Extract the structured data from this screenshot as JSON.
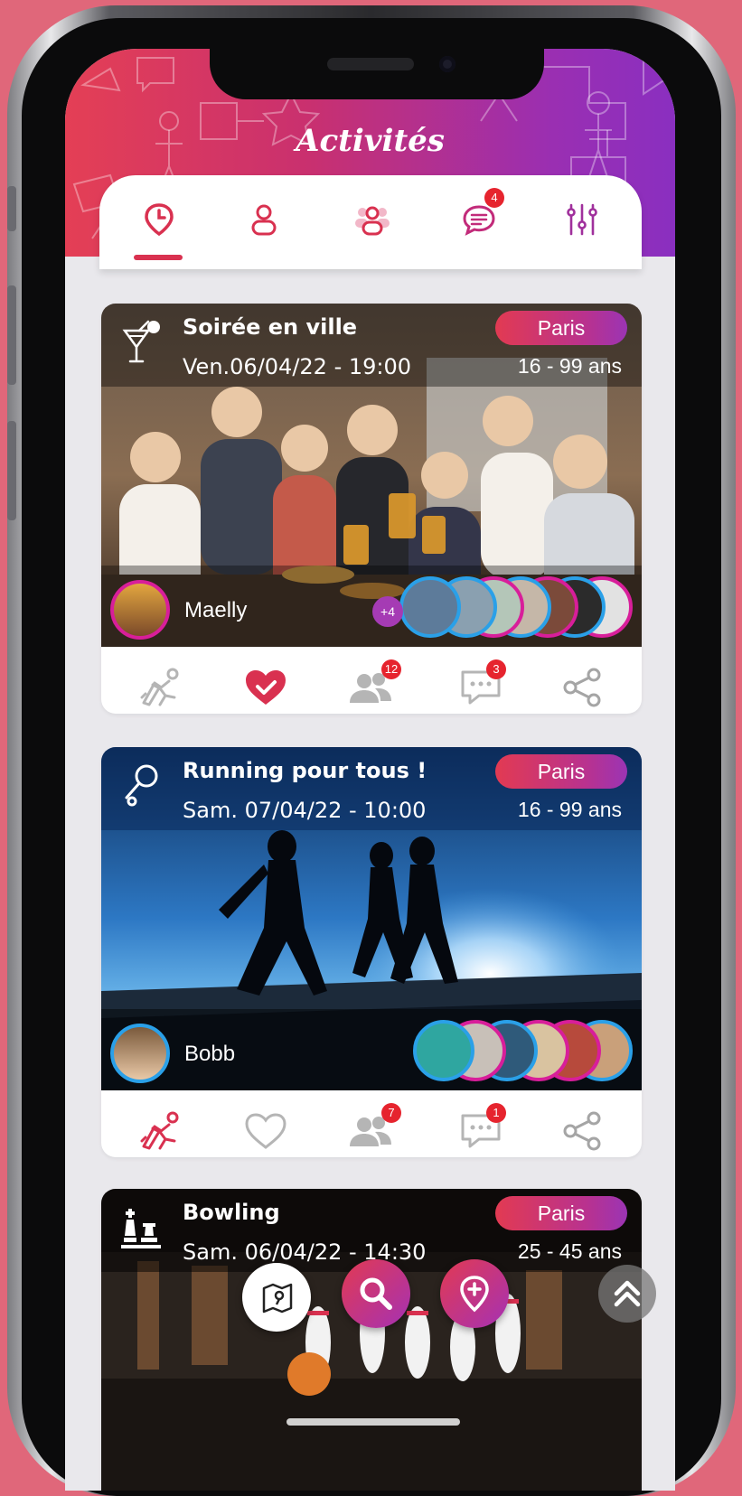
{
  "app": {
    "title": "Activités"
  },
  "tabs": [
    {
      "icon": "clock-pin-icon",
      "active": true,
      "badge": ""
    },
    {
      "icon": "person-icon",
      "active": false,
      "badge": ""
    },
    {
      "icon": "group-icon",
      "active": false,
      "badge": ""
    },
    {
      "icon": "chat-icon",
      "active": false,
      "badge": "4"
    },
    {
      "icon": "filters-icon",
      "active": false,
      "badge": ""
    }
  ],
  "activities": [
    {
      "category_icon": "cocktail-icon",
      "title": "Soirée en ville",
      "date": "Ven.06/04/22 - 19:00",
      "city": "Paris",
      "age_range": "16 - 99 ans",
      "owner": "Maelly",
      "extra_participants": "+4",
      "liked": true,
      "joined": false,
      "participants_count": "12",
      "comments_count": "3"
    },
    {
      "category_icon": "running-icon",
      "title": "Running pour tous !",
      "date": "Sam. 07/04/22 - 10:00",
      "city": "Paris",
      "age_range": "16 - 99 ans",
      "owner": "Bobb",
      "extra_participants": "",
      "liked": false,
      "joined": true,
      "participants_count": "7",
      "comments_count": "1"
    },
    {
      "category_icon": "chess-icon",
      "title": "Bowling",
      "date": "Sam. 06/04/22 - 14:30",
      "city": "Paris",
      "age_range": "25 - 45 ans"
    }
  ],
  "colors": {
    "accent_red": "#d93150",
    "gradient_start": "#e43f55",
    "gradient_end": "#8a2fc0",
    "badge_red": "#e6242e",
    "avatar_blue_ring": "#2aa0e8",
    "avatar_pink_ring": "#d81e9a"
  },
  "floating_buttons": [
    {
      "icon": "map-icon"
    },
    {
      "icon": "search-icon"
    },
    {
      "icon": "add-location-icon"
    },
    {
      "icon": "scroll-top-icon"
    }
  ]
}
